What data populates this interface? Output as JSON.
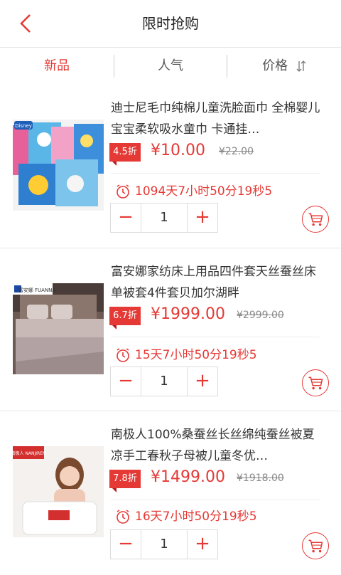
{
  "header": {
    "title": "限时抢购"
  },
  "tabs": [
    {
      "label": "新品",
      "active": true
    },
    {
      "label": "人气",
      "active": false
    },
    {
      "label": "价格",
      "active": false
    }
  ],
  "products": [
    {
      "title": "迪士尼毛巾纯棉儿童洗脸面巾 全棉婴儿宝宝柔软吸水童巾 卡通挂…",
      "discount": "4.5折",
      "price": "¥10.00",
      "old_price": "¥22.00",
      "countdown": "1094天7小时50分19秒5",
      "quantity": "1",
      "image_brand": "Disney"
    },
    {
      "title": "富安娜家纺床上用品四件套天丝蚕丝床单被套4件套贝加尔湖畔",
      "discount": "6.7折",
      "price": "¥1999.00",
      "old_price": "¥2999.00",
      "countdown": "15天7小时50分19秒5",
      "quantity": "1",
      "image_brand": "富安娜 FUANNA"
    },
    {
      "title": "南极人100%桑蚕丝长丝绵纯蚕丝被夏凉手工春秋子母被儿童冬优…",
      "discount": "7.8折",
      "price": "¥1499.00",
      "old_price": "¥1918.00",
      "countdown": "16天7小时50分19秒5",
      "quantity": "1",
      "image_brand": "南极人 NANJIREN"
    }
  ],
  "stepper": {
    "minus": "−",
    "plus": "+"
  },
  "colors": {
    "accent": "#e53935",
    "divider": "#e6e6e6"
  },
  "icons": [
    "back-arrow-icon",
    "sort-icon",
    "clock-icon",
    "cart-icon"
  ]
}
